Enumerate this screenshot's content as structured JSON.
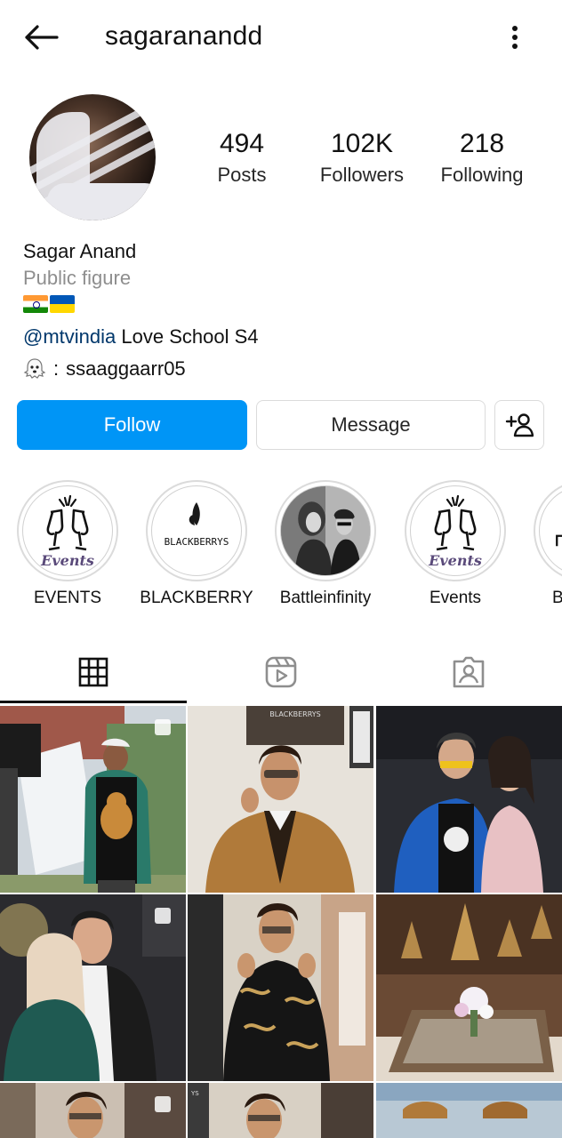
{
  "header": {
    "username": "sagaranandd",
    "back_icon": "arrow-left-icon",
    "more_icon": "more-vertical-icon"
  },
  "profile": {
    "stats": [
      {
        "value": "494",
        "label": "Posts"
      },
      {
        "value": "102K",
        "label": "Followers"
      },
      {
        "value": "218",
        "label": "Following"
      }
    ],
    "name": "Sagar Anand",
    "category": "Public figure",
    "mention": "@mtvindia",
    "bio_text": " Love School S4",
    "snap_separator": ":",
    "snap_handle": "ssaaggaarr05"
  },
  "actions": {
    "follow_label": "Follow",
    "message_label": "Message"
  },
  "highlights": [
    {
      "label": "EVENTS",
      "icon": "champagne-events-icon"
    },
    {
      "label": "BLACKBERRY",
      "icon": "blackberrys-logo"
    },
    {
      "label": "Battleinfinity",
      "icon": "photo-thumbnail"
    },
    {
      "label": "Events",
      "icon": "champagne-events-icon"
    },
    {
      "label": "B",
      "icon": "partial-highlight"
    }
  ],
  "highlight_art_text": {
    "events_word": "Events",
    "blackberrys_word": "BLACKBERRYS"
  },
  "tabs": [
    {
      "name": "posts-grid",
      "icon": "grid-icon",
      "active": true
    },
    {
      "name": "reels",
      "icon": "reels-icon",
      "active": false
    },
    {
      "name": "tagged",
      "icon": "tagged-person-icon",
      "active": false
    }
  ],
  "grid_overlay_text": {
    "post2_sign": "BLACKBERRYS",
    "post8_sign": "YS"
  },
  "colors": {
    "follow_blue": "#0095f6",
    "mention_navy": "#00376b",
    "secondary_text": "#8e8e8e",
    "border": "#dbdbdb"
  }
}
